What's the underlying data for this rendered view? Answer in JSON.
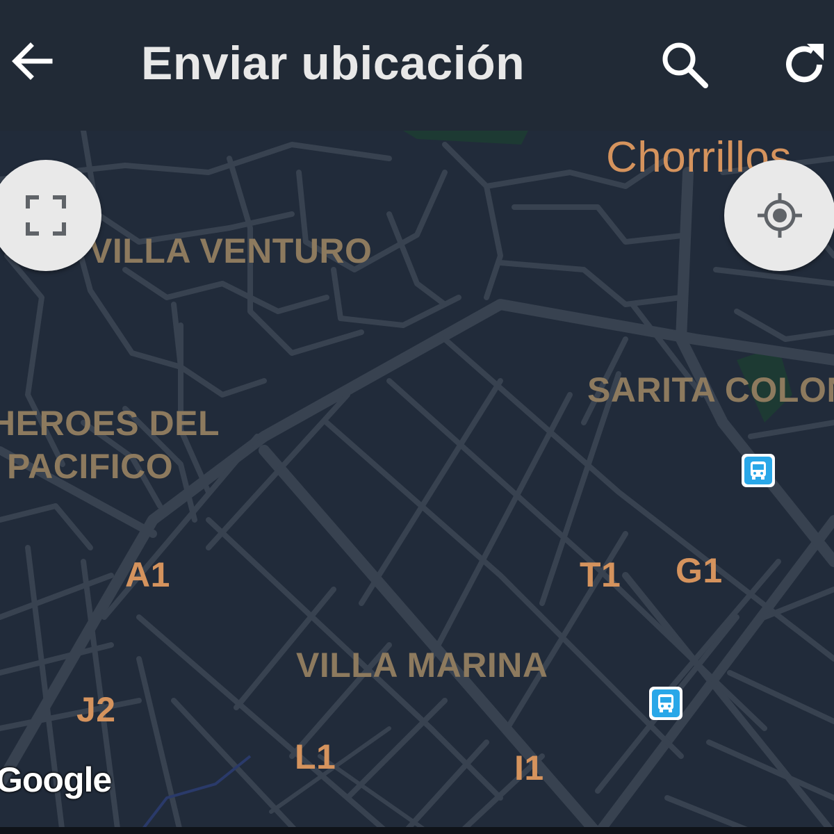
{
  "appbar": {
    "title": "Enviar ubicación",
    "back_icon": "arrow-left-icon",
    "search_icon": "search-icon",
    "refresh_icon": "refresh-icon"
  },
  "map": {
    "labels": {
      "chorrillos": "Chorrillos",
      "villa_venturo": "VILLA VENTURO",
      "sarita_colonia": "SARITA COLON",
      "heroes_line1": "HEROES DEL",
      "heroes_line2": "PACIFICO",
      "villa_marina": "VILLA MARINA",
      "a1": "A1",
      "t1": "T1",
      "g1": "G1",
      "j2": "J2",
      "l1": "L1",
      "i1": "I1"
    },
    "fullscreen_icon": "fullscreen-icon",
    "my_location_icon": "my-location-icon",
    "bus_icon": "bus-stop-icon",
    "attribution": "Google"
  },
  "colors": {
    "appbar": "#212a36",
    "map_background": "#212b3a",
    "road": "#384250",
    "area_label": "#8d7a5e",
    "code_label": "#d5935d",
    "bus_blue": "#29a7e8"
  }
}
